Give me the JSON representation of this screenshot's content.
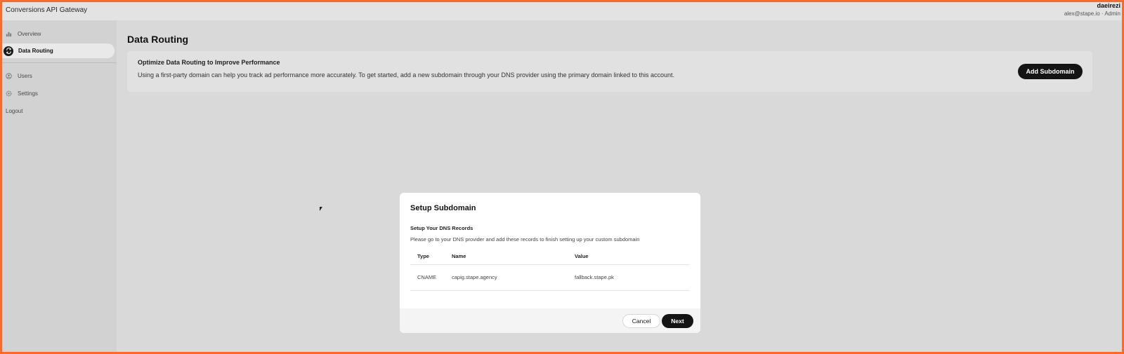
{
  "app": {
    "title": "Conversions API Gateway",
    "user_name": "daeirezi",
    "user_meta": "alex@stape.io · Admin"
  },
  "sidebar": {
    "items": [
      {
        "label": "Overview",
        "icon": "overview-icon",
        "active": false
      },
      {
        "label": "Data Routing",
        "icon": "routing-icon",
        "active": true
      },
      {
        "label": "Users",
        "icon": "users-icon",
        "active": false
      },
      {
        "label": "Settings",
        "icon": "gear-icon",
        "active": false
      }
    ],
    "logout_label": "Logout"
  },
  "main": {
    "page_title": "Data Routing",
    "card": {
      "title": "Optimize Data Routing to Improve Performance",
      "description": "Using a first-party domain can help you track ad performance more accurately. To get started, add a new subdomain through your DNS provider using the primary domain linked to this account.",
      "button_label": "Add Subdomain"
    }
  },
  "modal": {
    "title": "Setup Subdomain",
    "subtitle": "Setup Your DNS Records",
    "description": "Please go to your DNS provider and add these records to finish setting up your custom subdomain",
    "table": {
      "headers": [
        "Type",
        "Name",
        "Value"
      ],
      "rows": [
        {
          "type": "CNAME",
          "name": "capig.stape.agency",
          "value": "fallback.stape.pk"
        }
      ]
    },
    "cancel_label": "Cancel",
    "next_label": "Next"
  },
  "colors": {
    "accent_dark": "#141414",
    "border_orange": "#ff6a2b",
    "background": "#d9d9d9"
  }
}
